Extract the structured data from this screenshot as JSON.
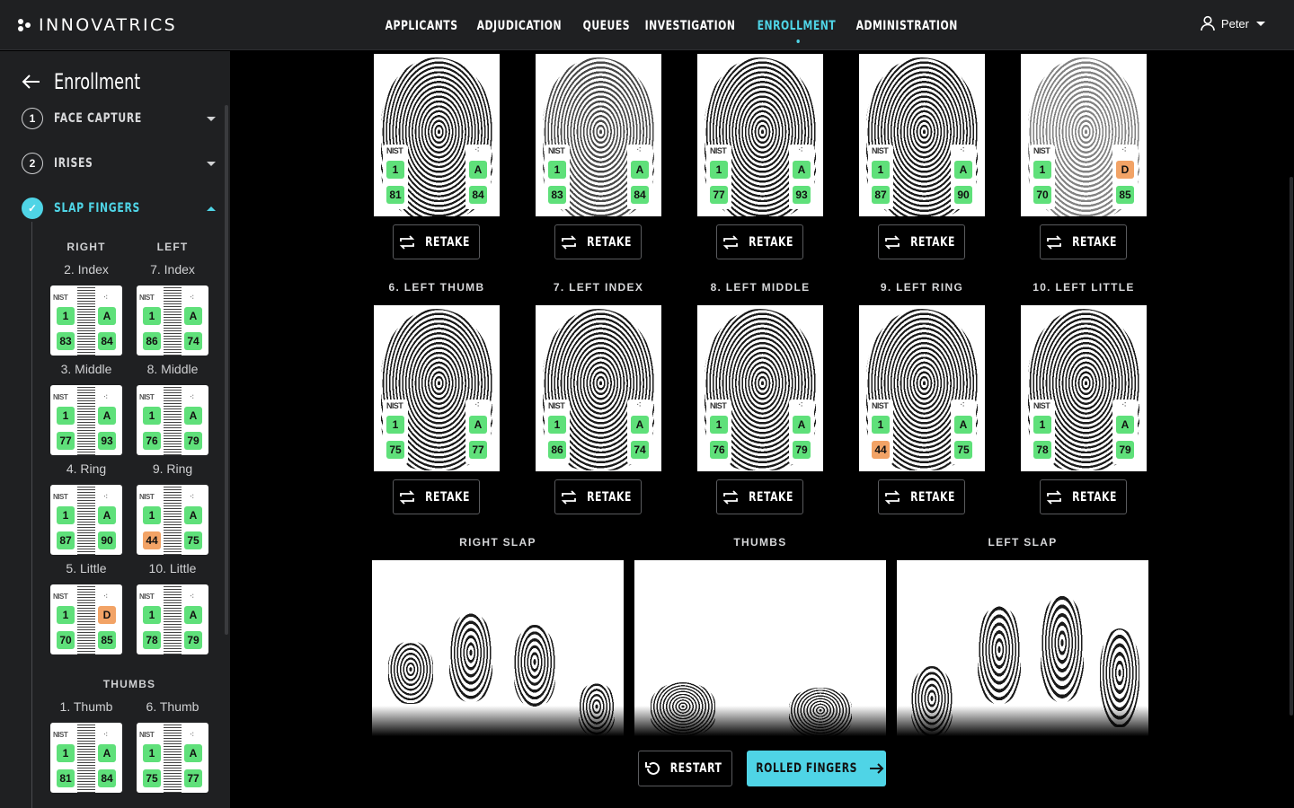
{
  "app": {
    "brand": "INNOVATRICS",
    "accent": "#4fd4e6"
  },
  "nav": {
    "items": [
      {
        "label": "APPLICANTS",
        "active": false
      },
      {
        "label": "ADJUDICATION",
        "active": false
      },
      {
        "label": "QUEUES",
        "active": false
      },
      {
        "label": "INVESTIGATION",
        "active": false
      },
      {
        "label": "ENROLLMENT",
        "active": true
      },
      {
        "label": "ADMINISTRATION",
        "active": false
      }
    ]
  },
  "user": {
    "name": "Peter"
  },
  "sidebar": {
    "title": "Enrollment",
    "steps": [
      {
        "num": "1",
        "label": "FACE CAPTURE"
      },
      {
        "num": "2",
        "label": "IRISES"
      },
      {
        "num": "✓",
        "label": "SLAP FINGERS"
      }
    ],
    "col_right": "RIGHT",
    "col_left": "LEFT",
    "thumbs_heading": "THUMBS",
    "fingers": [
      {
        "name": "2. Index",
        "nist": "NIST",
        "q1": "1",
        "grade": "A",
        "s1": "83",
        "s2": "84"
      },
      {
        "name": "7. Index",
        "nist": "NIST",
        "q1": "1",
        "grade": "A",
        "s1": "86",
        "s2": "74"
      },
      {
        "name": "3. Middle",
        "nist": "NIST",
        "q1": "1",
        "grade": "A",
        "s1": "77",
        "s2": "93"
      },
      {
        "name": "8. Middle",
        "nist": "NIST",
        "q1": "1",
        "grade": "A",
        "s1": "76",
        "s2": "79"
      },
      {
        "name": "4. Ring",
        "nist": "NIST",
        "q1": "1",
        "grade": "A",
        "s1": "87",
        "s2": "90"
      },
      {
        "name": "9. Ring",
        "nist": "NIST",
        "q1": "1",
        "grade": "A",
        "s1": "44",
        "s2": "75"
      },
      {
        "name": "5. Little",
        "nist": "NIST",
        "q1": "1",
        "grade": "D",
        "s1": "70",
        "s2": "85"
      },
      {
        "name": "10. Little",
        "nist": "NIST",
        "q1": "1",
        "grade": "A",
        "s1": "78",
        "s2": "79"
      },
      {
        "name": "1. Thumb",
        "nist": "NIST",
        "q1": "1",
        "grade": "A",
        "s1": "81",
        "s2": "84"
      },
      {
        "name": "6. Thumb",
        "nist": "NIST",
        "q1": "1",
        "grade": "A",
        "s1": "75",
        "s2": "77"
      }
    ]
  },
  "main": {
    "retake_label": "RETAKE",
    "top_row": [
      {
        "nist": "NIST",
        "q1": "1",
        "grade": "A",
        "s1": "81",
        "s2": "84"
      },
      {
        "nist": "NIST",
        "q1": "1",
        "grade": "A",
        "s1": "83",
        "s2": "84"
      },
      {
        "nist": "NIST",
        "q1": "1",
        "grade": "A",
        "s1": "77",
        "s2": "93"
      },
      {
        "nist": "NIST",
        "q1": "1",
        "grade": "A",
        "s1": "87",
        "s2": "90"
      },
      {
        "nist": "NIST",
        "q1": "1",
        "grade": "D",
        "s1": "70",
        "s2": "85"
      }
    ],
    "left_row": [
      {
        "title": "6. LEFT THUMB",
        "nist": "NIST",
        "q1": "1",
        "grade": "A",
        "s1": "75",
        "s2": "77"
      },
      {
        "title": "7. LEFT INDEX",
        "nist": "NIST",
        "q1": "1",
        "grade": "A",
        "s1": "86",
        "s2": "74"
      },
      {
        "title": "8. LEFT MIDDLE",
        "nist": "NIST",
        "q1": "1",
        "grade": "A",
        "s1": "76",
        "s2": "79"
      },
      {
        "title": "9. LEFT RING",
        "nist": "NIST",
        "q1": "1",
        "grade": "A",
        "s1": "44",
        "s2": "75"
      },
      {
        "title": "10. LEFT LITTLE",
        "nist": "NIST",
        "q1": "1",
        "grade": "A",
        "s1": "78",
        "s2": "79"
      }
    ],
    "slaps": [
      {
        "title": "RIGHT SLAP"
      },
      {
        "title": "THUMBS"
      },
      {
        "title": "LEFT SLAP"
      }
    ],
    "restart_label": "RESTART",
    "next_label": "ROLLED FINGERS"
  }
}
